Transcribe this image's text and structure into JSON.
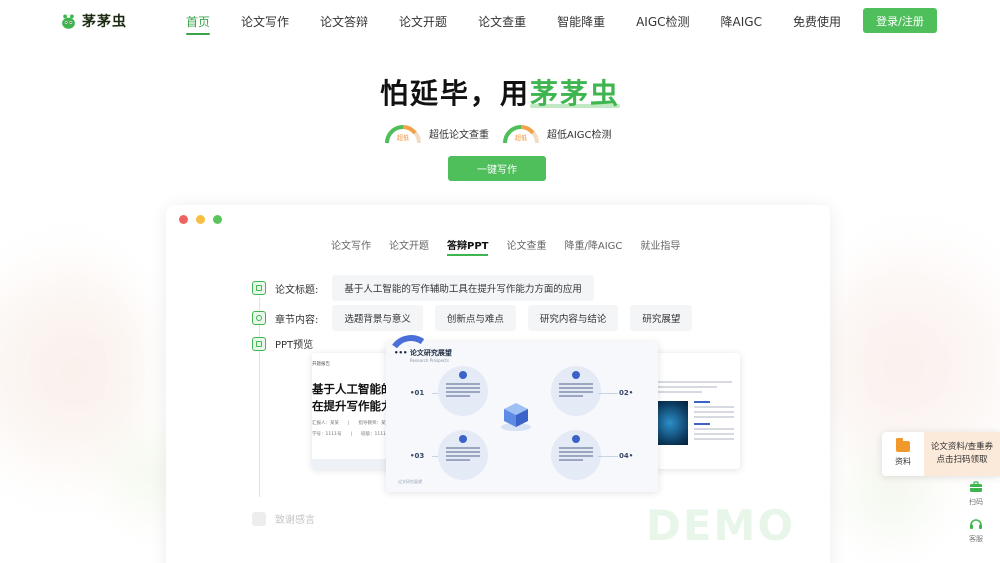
{
  "brand": {
    "name": "茅茅虫",
    "accent": "#4fbf5c"
  },
  "nav": {
    "items": [
      {
        "label": "首页",
        "active": true
      },
      {
        "label": "论文写作"
      },
      {
        "label": "论文答辩"
      },
      {
        "label": "论文开题"
      },
      {
        "label": "论文查重"
      },
      {
        "label": "智能降重"
      },
      {
        "label": "AIGC检测"
      },
      {
        "label": "降AIGC"
      },
      {
        "label": "免费使用"
      }
    ],
    "login_label": "登录/注册"
  },
  "hero": {
    "title_prefix": "怕延毕，用",
    "title_brand": "茅茅虫",
    "badges": [
      {
        "gauge_text": "超低",
        "label": "超低论文查重"
      },
      {
        "gauge_text": "超低",
        "label": "超低AIGC检测"
      }
    ],
    "cta_label": "一键写作"
  },
  "panel": {
    "window_dots": [
      "#f0625d",
      "#f7be41",
      "#5ac55a"
    ],
    "tabs": [
      {
        "label": "论文写作"
      },
      {
        "label": "论文开题"
      },
      {
        "label": "答辩PPT",
        "active": true
      },
      {
        "label": "论文查重"
      },
      {
        "label": "降重/降AIGC"
      },
      {
        "label": "就业指导"
      }
    ],
    "title_row": {
      "label": "论文标题:",
      "value": "基于人工智能的写作辅助工具在提升写作能力方面的应用"
    },
    "chapter_row": {
      "label": "章节内容:",
      "chips": [
        "选题背景与意义",
        "创新点与难点",
        "研究内容与结论",
        "研究展望"
      ]
    },
    "ppt_label": "PPT预览",
    "ack_label": "致谢感言",
    "watermark": "DEMO",
    "slide_left": {
      "tag": "开题报告",
      "title_line1": "基于人工智能的写",
      "title_line2": "在提升写作能力方",
      "meta_line1": "汇报人：某某　　|　　指导教师：某某",
      "meta_line2": "学号：1111号　　|　　班级：1111班"
    },
    "slide_center": {
      "title": "论文研究展望",
      "subtitle": "Research Prospects",
      "numbers": [
        "01",
        "02",
        "03",
        "04"
      ],
      "footer": "论文研究展望"
    }
  },
  "float_card": {
    "left_label": "资料",
    "line1": "论文资料/查重券",
    "line2": "点击扫码领取"
  },
  "side_tools": [
    {
      "icon": "briefcase-icon",
      "label": "扫码"
    },
    {
      "icon": "headset-icon",
      "label": "客服"
    }
  ]
}
